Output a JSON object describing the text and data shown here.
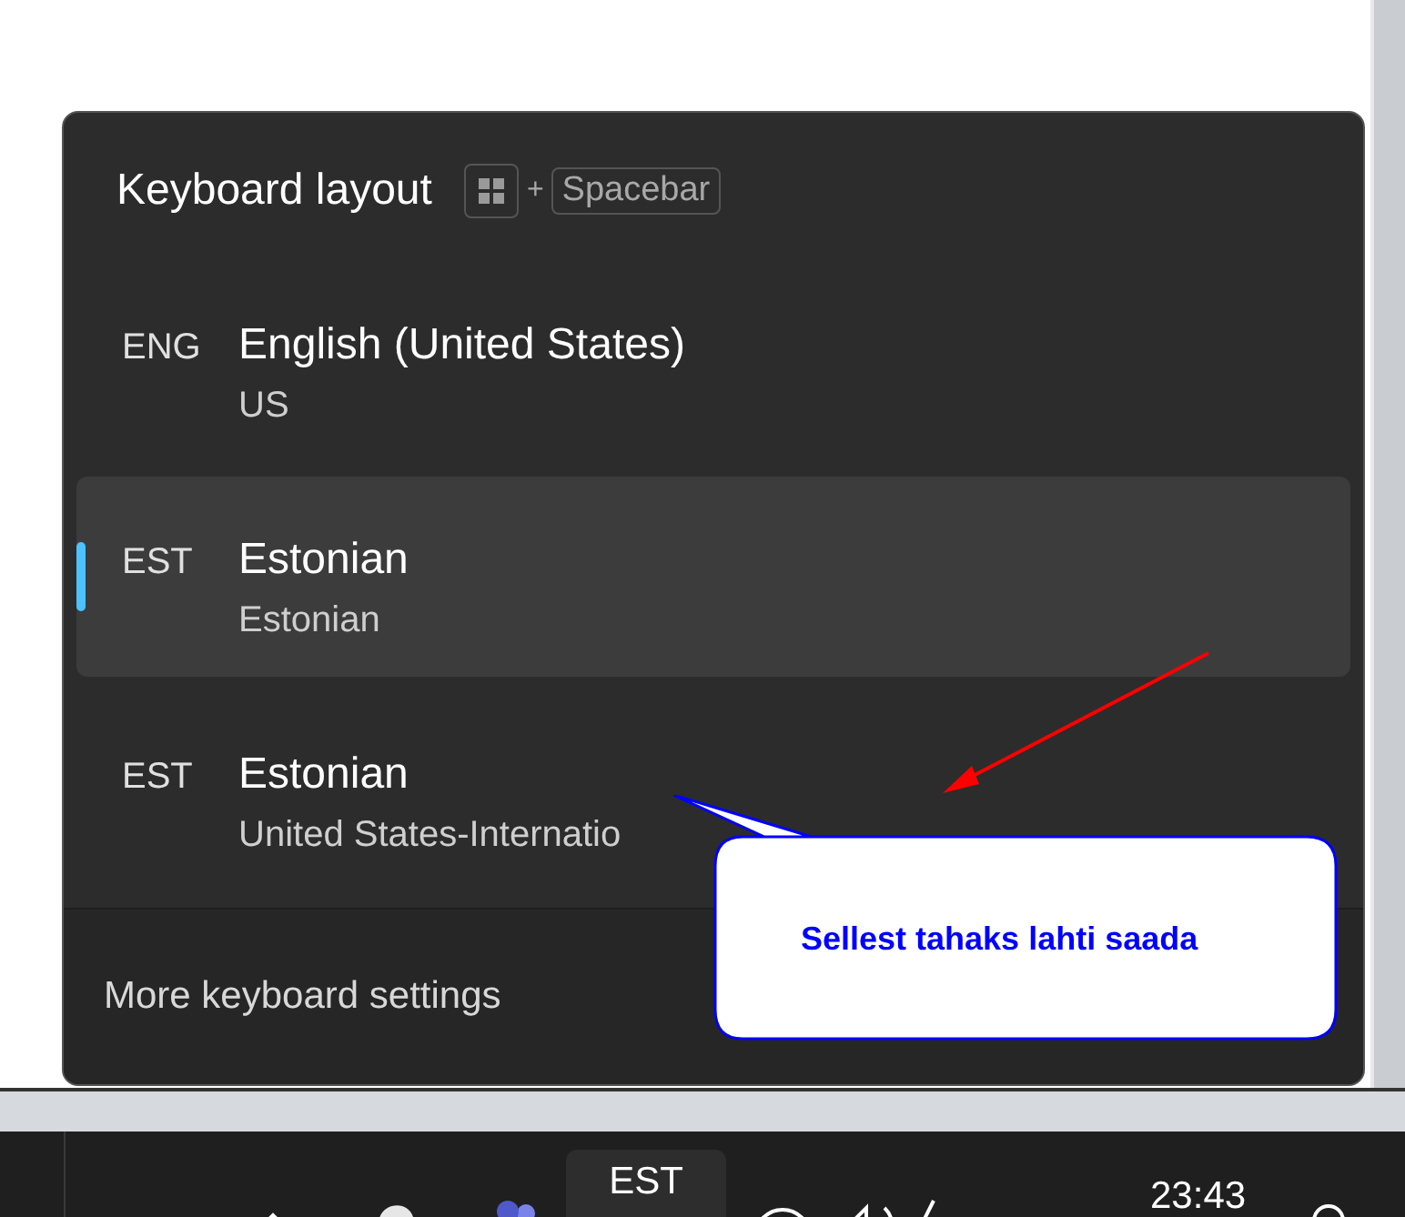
{
  "panel": {
    "title": "Keyboard layout",
    "shortcut": {
      "plus": "+",
      "key": "Spacebar"
    },
    "items": [
      {
        "code": "ENG",
        "name": "English (United States)",
        "layout": "US",
        "selected": false
      },
      {
        "code": "EST",
        "name": "Estonian",
        "layout": "Estonian",
        "selected": true
      },
      {
        "code": "EST",
        "name": "Estonian",
        "layout": "United States-Internatio",
        "selected": false
      }
    ],
    "footer_link": "More keyboard settings"
  },
  "callout": {
    "text": "Sellest tahaks lahti saada"
  },
  "taskbar": {
    "language": "EST",
    "clock": "23:43"
  }
}
